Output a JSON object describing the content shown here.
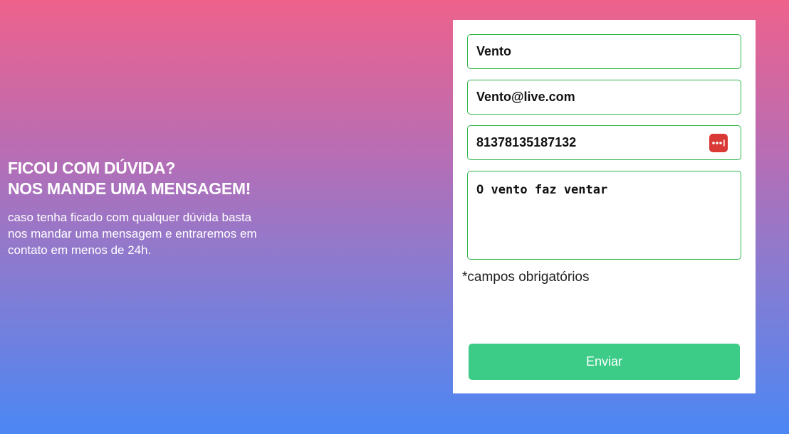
{
  "intro": {
    "title_line1": "FICOU COM DÚVIDA?",
    "title_line2": "NOS MANDE UMA MENSAGEM!",
    "text": "caso tenha ficado com qualquer dúvida basta nos mandar uma mensagem e entraremos em contato em menos de 24h."
  },
  "form": {
    "name_value": "Vento",
    "email_value": "Vento@live.com",
    "phone_value": "81378135187132",
    "message_value": "O vento faz ventar",
    "password_icon": "password-manager-icon",
    "required_note": "*campos obrigatórios",
    "submit_label": "Enviar"
  },
  "colors": {
    "gradient_top": "#ee628c",
    "gradient_bottom": "#4b87f4",
    "field_border": "#2fb54a",
    "submit_bg": "#3ccc88",
    "icon_bg": "#d93a35"
  }
}
